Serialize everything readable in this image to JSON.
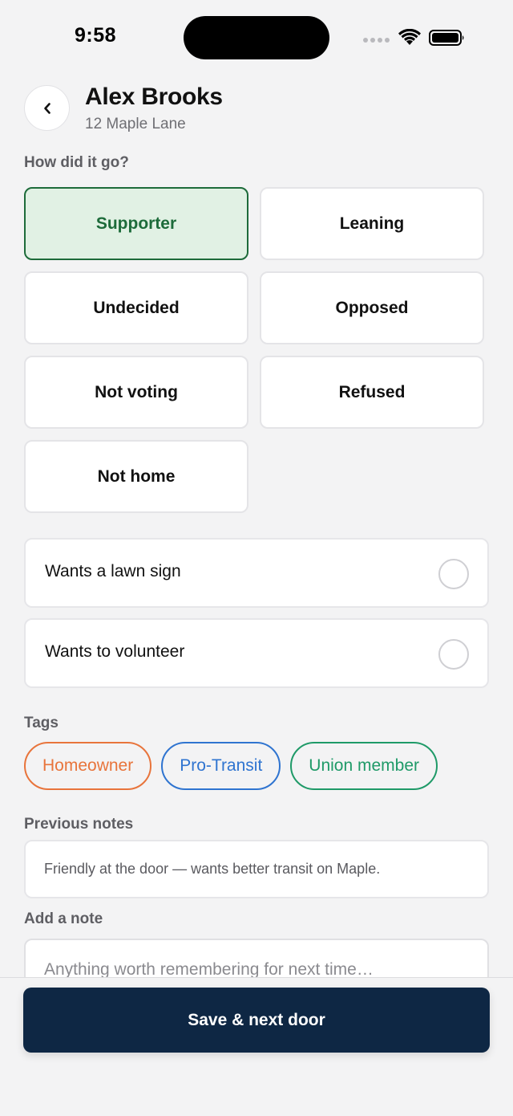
{
  "status_bar": {
    "time": "9:58"
  },
  "header": {
    "name": "Alex Brooks",
    "address": "12 Maple Lane"
  },
  "outcome": {
    "question": "How did it go?",
    "options": [
      "Supporter",
      "Leaning",
      "Undecided",
      "Opposed",
      "Not voting",
      "Refused",
      "Not home"
    ],
    "selected": "Supporter"
  },
  "toggles": [
    {
      "label": "Wants a lawn sign",
      "checked": false
    },
    {
      "label": "Wants to volunteer",
      "checked": false
    }
  ],
  "tags": {
    "label": "Tags",
    "items": [
      {
        "label": "Homeowner",
        "color": "#e8743b"
      },
      {
        "label": "Pro-Transit",
        "color": "#2f74d0"
      },
      {
        "label": "Union member",
        "color": "#1f9a68"
      }
    ]
  },
  "notes": {
    "previous_label": "Previous notes",
    "previous_text": "Friendly at the door — wants better transit on Maple.",
    "add_label": "Add a note",
    "add_placeholder": "Anything worth remembering for next time…"
  },
  "actions": {
    "save_label": "Save & next door"
  },
  "colors": {
    "primary": "#0e2744",
    "selected_bg": "#e1f1e4",
    "selected_fg": "#1d6b3a"
  }
}
